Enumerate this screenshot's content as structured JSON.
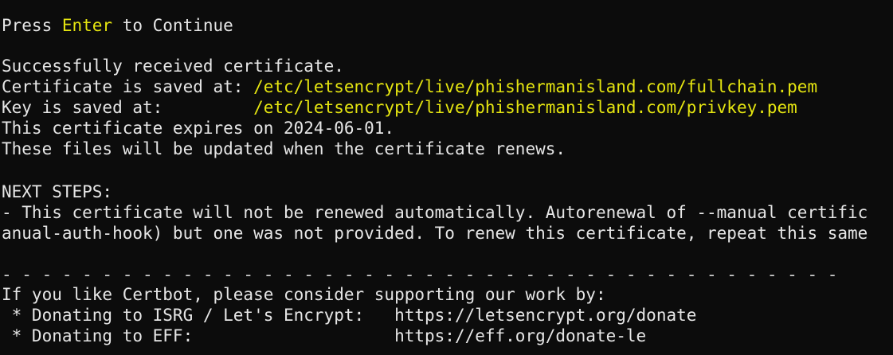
{
  "terminal": {
    "dash_top": "- - - - - - - - - - - - - - - - - - - - - - - - - - - - - - - - - - - - - - - - - -",
    "press_enter": {
      "before": "Press ",
      "key": "Enter",
      "after": " to Continue"
    },
    "success": "Successfully received certificate.",
    "cert_saved": {
      "label": "Certificate is saved at: ",
      "path": "/etc/letsencrypt/live/phishermanisland.com/fullchain.pem"
    },
    "key_saved": {
      "label": "Key is saved at:         ",
      "path": "/etc/letsencrypt/live/phishermanisland.com/privkey.pem"
    },
    "expires": "This certificate expires on 2024-06-01.",
    "renews": "These files will be updated when the certificate renews.",
    "next_steps_heading": "NEXT STEPS:",
    "next_steps_line1": "- This certificate will not be renewed automatically. Autorenewal of --manual certific",
    "next_steps_line2": "anual-auth-hook) but one was not provided. To renew this certificate, repeat this same",
    "dash_mid": "- - - - - - - - - - - - - - - - - - - - - - - - - - - - - - - - - - - - - - - - - -",
    "support_line": "If you like Certbot, please consider supporting our work by:",
    "donate_isrg": {
      "label": " * Donating to ISRG / Let's Encrypt:   ",
      "url": "https://letsencrypt.org/donate"
    },
    "donate_eff": {
      "label": " * Donating to EFF:                    ",
      "url": "https://eff.org/donate-le"
    },
    "dash_bottom": "- - - - - - - - - - - - - - - - - - - - - - - - - - - - - - - - - - - - - - - - - -",
    "colors": {
      "background": "#0c0c0c",
      "text": "#e6e6e6",
      "highlight": "#e5e510"
    }
  }
}
